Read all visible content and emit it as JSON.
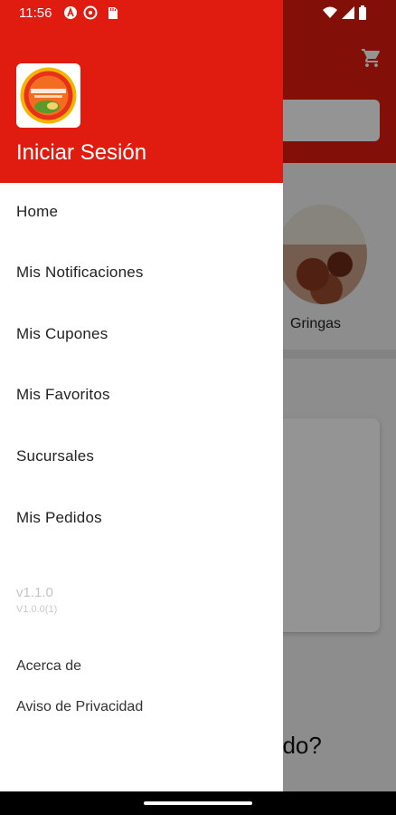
{
  "status_bar": {
    "time": "11:56",
    "icons": [
      "a-circle-icon",
      "settings-icon",
      "sd-card-icon",
      "wifi-icon",
      "signal-icon",
      "battery-icon"
    ]
  },
  "drawer": {
    "header_color": "#e01b0f",
    "login_label": "Iniciar Sesión",
    "menu": [
      {
        "label": "Home"
      },
      {
        "label": "Mis Notificaciones"
      },
      {
        "label": "Mis Cupones"
      },
      {
        "label": "Mis Favoritos"
      },
      {
        "label": "Sucursales"
      },
      {
        "label": "Mis Pedidos"
      }
    ],
    "version": "v1.1.0",
    "build": "V1.0.0(1)",
    "footer_links": [
      {
        "label": "Acerca de"
      },
      {
        "label": "Aviso de Privacidad"
      }
    ]
  },
  "background": {
    "category_label": "Gringas",
    "partial_question": "ado?"
  }
}
